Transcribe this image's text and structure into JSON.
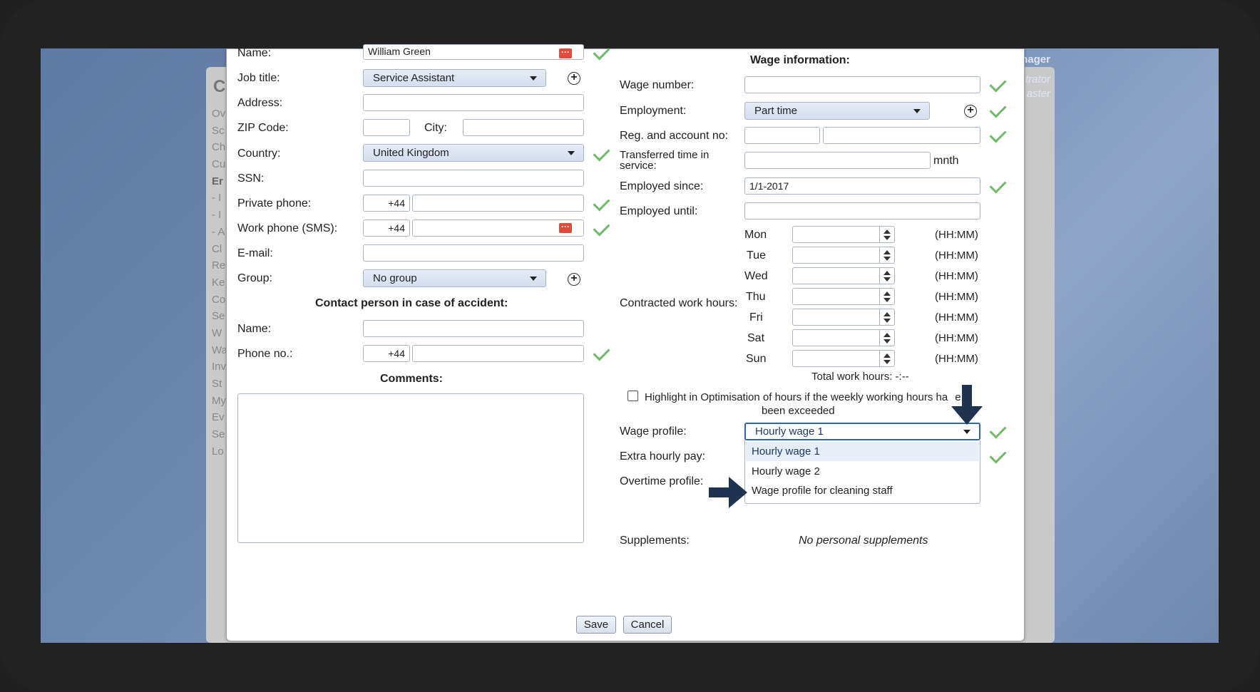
{
  "background": {
    "side_items": [
      "Ov",
      "Sc",
      "Ch",
      "Cu",
      "Er",
      "- I",
      "- I",
      "- A",
      "Cl",
      "Re",
      "Ke",
      "Co",
      "Se",
      "W",
      "Wa",
      "Inv",
      "St",
      "My",
      "Ev",
      "Se",
      "Lo"
    ],
    "right_labels": {
      "manager": "nager",
      "administrator": "trator",
      "master": "aster"
    },
    "panel_letter": "C"
  },
  "left": {
    "name_label": "Name:",
    "name_value": "William Green",
    "job_title_label": "Job title:",
    "job_title_value": "Service Assistant",
    "address_label": "Address:",
    "zip_label": "ZIP Code:",
    "city_label": "City:",
    "country_label": "Country:",
    "country_value": "United Kingdom",
    "ssn_label": "SSN:",
    "private_phone_label": "Private phone:",
    "private_phone_prefix": "+44",
    "work_phone_label": "Work phone (SMS):",
    "work_phone_prefix": "+44",
    "email_label": "E-mail:",
    "group_label": "Group:",
    "group_value": "No group",
    "contact_heading": "Contact person in case of accident:",
    "contact_name_label": "Name:",
    "contact_phone_label": "Phone no.:",
    "contact_phone_prefix": "+44",
    "comments_heading": "Comments:"
  },
  "right": {
    "wage_heading": "Wage information:",
    "wage_number_label": "Wage number:",
    "employment_label": "Employment:",
    "employment_value": "Part time",
    "reg_account_label": "Reg. and account no:",
    "transferred_label_1": "Transferred time in",
    "transferred_label_2": "service:",
    "transferred_unit": "mnth",
    "employed_since_label": "Employed since:",
    "employed_since_value": "1/1-2017",
    "employed_until_label": "Employed until:",
    "contracted_label": "Contracted work hours:",
    "days": [
      {
        "day": "Mon",
        "unit": "(HH:MM)"
      },
      {
        "day": "Tue",
        "unit": "(HH:MM)"
      },
      {
        "day": "Wed",
        "unit": "(HH:MM)"
      },
      {
        "day": "Thu",
        "unit": "(HH:MM)"
      },
      {
        "day": "Fri",
        "unit": "(HH:MM)"
      },
      {
        "day": "Sat",
        "unit": "(HH:MM)"
      },
      {
        "day": "Sun",
        "unit": "(HH:MM)"
      }
    ],
    "total_hours": "Total work hours: -:--",
    "highlight_text_1": "Highlight in Optimisation of hours if the weekly working hours ha",
    "highlight_text_tail": "e",
    "highlight_text_2": "been exceeded",
    "wage_profile_label": "Wage profile:",
    "wage_profile_value": "Hourly wage 1",
    "wage_profile_options": [
      "Hourly wage 1",
      "Hourly wage 2",
      "Wage profile for cleaning staff"
    ],
    "extra_pay_label": "Extra hourly pay:",
    "overtime_label": "Overtime profile:",
    "supplements_label": "Supplements:",
    "supplements_value": "No personal supplements"
  },
  "buttons": {
    "save": "Save",
    "cancel": "Cancel"
  },
  "colors": {
    "accent": "#2c64b8",
    "check": "#6fba6a",
    "arrow": "#1f3350",
    "error": "#e14b3b"
  }
}
